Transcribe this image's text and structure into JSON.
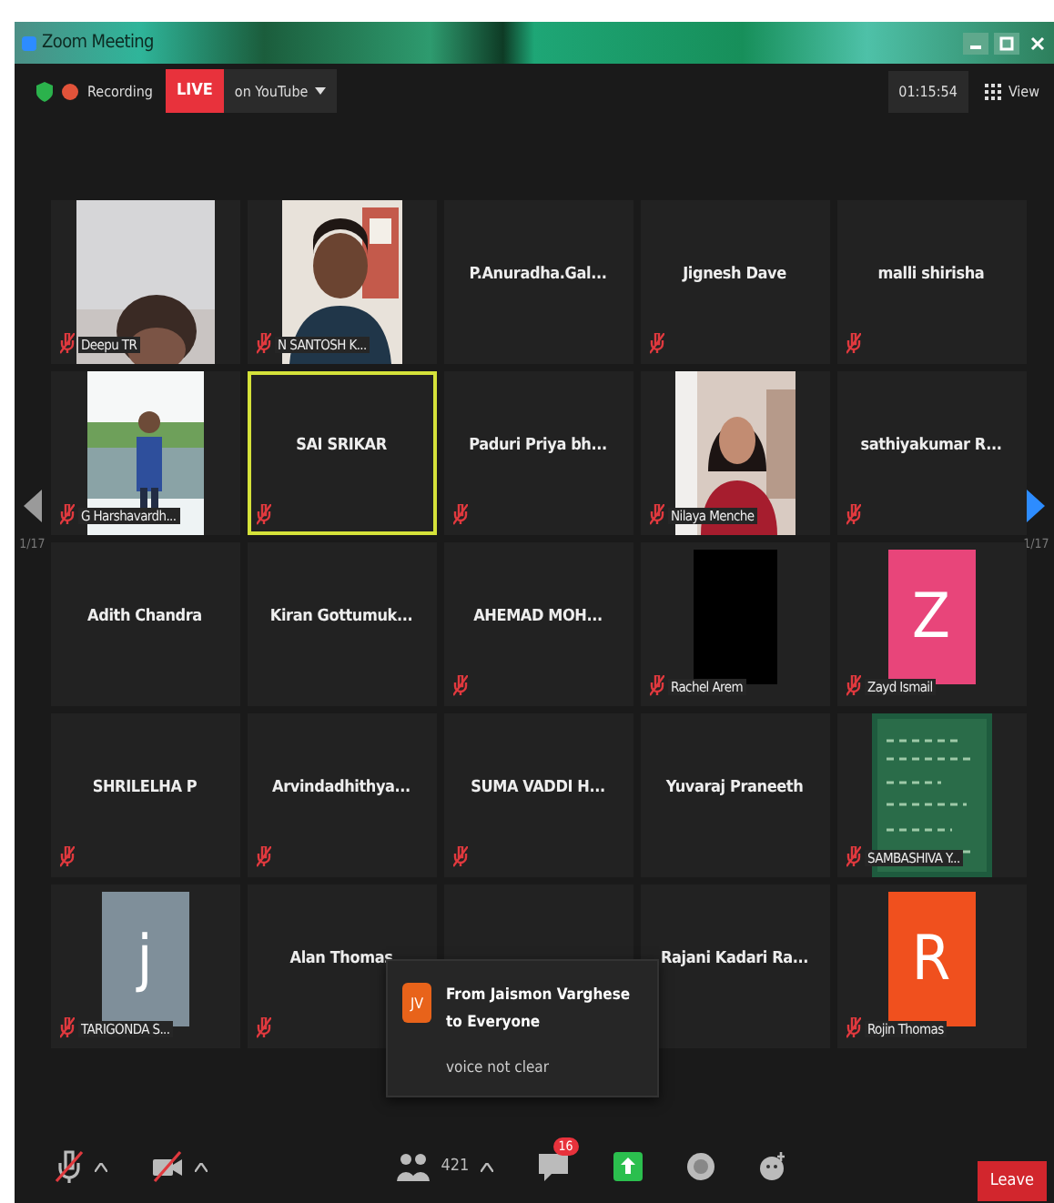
{
  "window": {
    "title": "Zoom Meeting"
  },
  "top_bar": {
    "recording": "Recording",
    "live": "LIVE",
    "live_target": "on YouTube",
    "timer": "01:15:54",
    "view": "View"
  },
  "pagination": {
    "left": "1/17",
    "right": "1/17"
  },
  "tiles": [
    {
      "kind": "video",
      "label": "Deepu TR",
      "muted": true,
      "speaking": false
    },
    {
      "kind": "video",
      "label": "N SANTOSH K...",
      "muted": true,
      "speaking": false
    },
    {
      "kind": "name",
      "name": "P.Anuradha.Gal...",
      "muted": false,
      "speaking": false
    },
    {
      "kind": "name",
      "name": "Jignesh Dave",
      "muted": true,
      "speaking": false
    },
    {
      "kind": "name",
      "name": "malli shirisha",
      "muted": true,
      "speaking": false
    },
    {
      "kind": "video",
      "label": "G Harshavardh...",
      "muted": true,
      "speaking": false
    },
    {
      "kind": "name",
      "name": "SAI SRIKAR",
      "muted": true,
      "speaking": true
    },
    {
      "kind": "name",
      "name": "Paduri  Priya  bh...",
      "muted": true,
      "speaking": false
    },
    {
      "kind": "video",
      "label": "Nilaya Menche",
      "muted": true,
      "speaking": false
    },
    {
      "kind": "name",
      "name": "sathiyakumar  R...",
      "muted": true,
      "speaking": false
    },
    {
      "kind": "name",
      "name": "Adith Chandra",
      "muted": false,
      "speaking": false
    },
    {
      "kind": "name",
      "name": "Kiran  Gottumuk...",
      "muted": false,
      "speaking": false
    },
    {
      "kind": "name",
      "name": "AHEMAD  MOH...",
      "muted": true,
      "speaking": false
    },
    {
      "kind": "blank",
      "label": "Rachel Arem",
      "muted": true,
      "speaking": false
    },
    {
      "kind": "avatar",
      "letter": "Z",
      "color": "#e8457a",
      "label": "Zayd Ismail",
      "muted": true,
      "speaking": false
    },
    {
      "kind": "name",
      "name": "SHRILELHA P",
      "muted": true,
      "speaking": false
    },
    {
      "kind": "name",
      "name": "Arvindadhithya...",
      "muted": true,
      "speaking": false
    },
    {
      "kind": "name",
      "name": "SUMA  VADDI  H...",
      "muted": true,
      "speaking": false
    },
    {
      "kind": "name",
      "name": "Yuvaraj Praneeth",
      "muted": false,
      "speaking": false
    },
    {
      "kind": "video",
      "label": "SAMBASHIVA Y...",
      "muted": true,
      "speaking": false
    },
    {
      "kind": "avatar",
      "letter": "j",
      "color": "#7f8f9a",
      "label": "TARIGONDA S...",
      "muted": true,
      "speaking": false
    },
    {
      "kind": "name",
      "name": "Alan  Thomas",
      "muted": true,
      "speaking": false
    },
    {
      "kind": "covered",
      "speaking": false
    },
    {
      "kind": "name",
      "name": "Rajani  Kadari  Ra...",
      "muted": false,
      "speaking": false
    },
    {
      "kind": "avatar",
      "letter": "R",
      "color": "#f0501e",
      "label": "Rojin Thomas",
      "muted": true,
      "speaking": false
    }
  ],
  "chat_notification": {
    "initials": "JV",
    "color": "#e8631a",
    "sender": "From Jaismon Varghese to Everyone",
    "message": "voice not clear"
  },
  "toolbar": {
    "audio_muted": true,
    "video_muted": true,
    "participants": "421",
    "chat_badge": "16",
    "leave": "Leave"
  }
}
